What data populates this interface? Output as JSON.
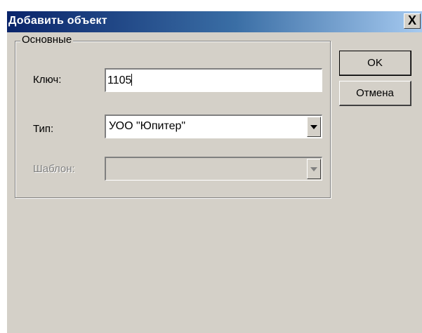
{
  "dialog": {
    "title": "Добавить объект",
    "close_glyph": "X"
  },
  "group": {
    "label": "Основные"
  },
  "fields": {
    "key_label": "Ключ:",
    "key_value": "1105",
    "type_label": "Тип:",
    "type_value": "УОО \"Юпитер\"",
    "template_label": "Шаблон:",
    "template_value": ""
  },
  "buttons": {
    "ok_label": "OK",
    "cancel_label": "Отмена"
  },
  "icons": {
    "close": "close-icon",
    "dropdown": "chevron-down-icon"
  },
  "colors": {
    "title_start": "#0a246a",
    "title_end": "#a6caf0",
    "face": "#d4d0c8"
  }
}
